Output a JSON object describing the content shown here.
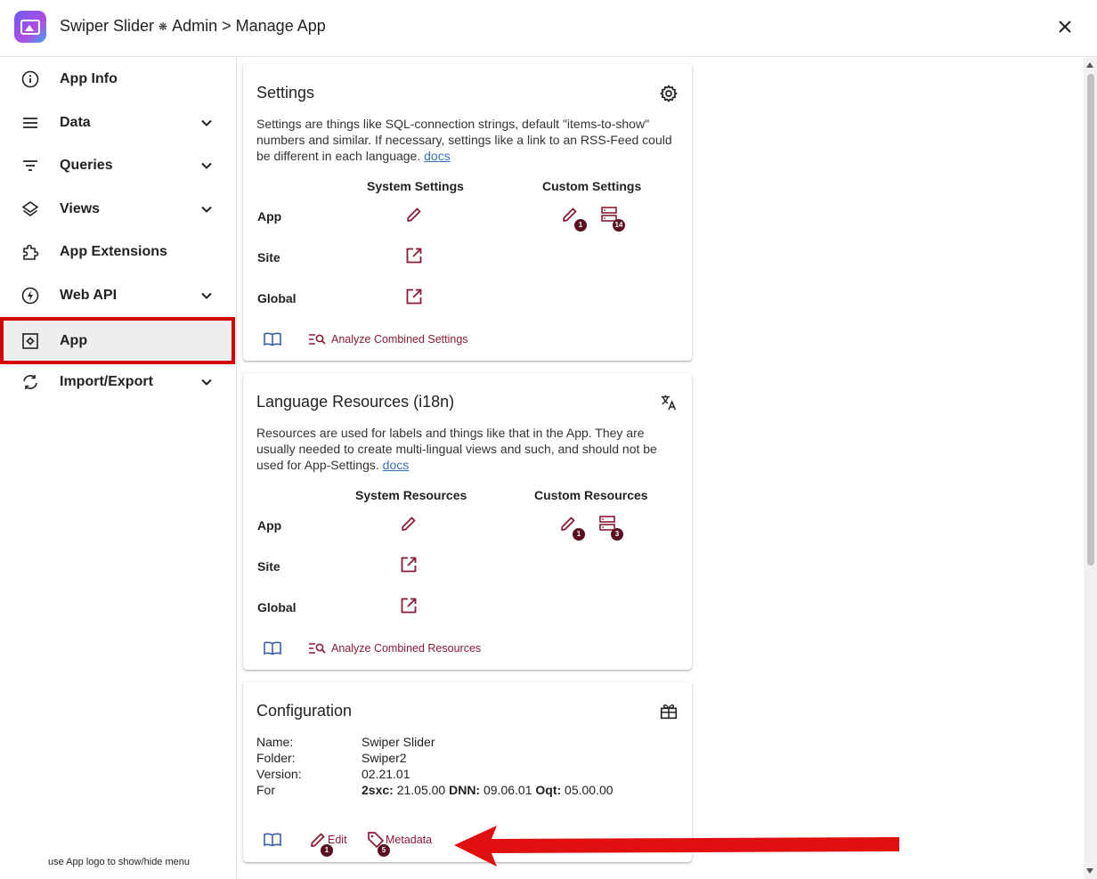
{
  "header": {
    "app_name": "Swiper Slider",
    "admin_label": "Admin",
    "separator": ">",
    "page_title": "Manage App"
  },
  "sidebar": {
    "items": [
      {
        "label": "App Info",
        "icon": "info-icon",
        "expandable": false
      },
      {
        "label": "Data",
        "icon": "list-icon",
        "expandable": true
      },
      {
        "label": "Queries",
        "icon": "filter-icon",
        "expandable": true
      },
      {
        "label": "Views",
        "icon": "layers-icon",
        "expandable": true
      },
      {
        "label": "App Extensions",
        "icon": "extension-icon",
        "expandable": false
      },
      {
        "label": "Web API",
        "icon": "bolt-icon",
        "expandable": true
      },
      {
        "label": "App",
        "icon": "settings-box-icon",
        "expandable": false,
        "active": true
      },
      {
        "label": "Import/Export",
        "icon": "sync-icon",
        "expandable": true
      }
    ],
    "hint": "use App logo to show/hide menu"
  },
  "settings_card": {
    "title": "Settings",
    "desc_text": "Settings are things like SQL-connection strings, default \"items-to-show\" numbers and similar. If necessary, settings like a link to an RSS-Feed could be different in each language.",
    "docs_link": "docs",
    "col_system": "System Settings",
    "col_custom": "Custom Settings",
    "rows": [
      "App",
      "Site",
      "Global"
    ],
    "custom_edit_badge": "1",
    "custom_list_badge": "14",
    "analyze_label": "Analyze Combined Settings"
  },
  "resources_card": {
    "title": "Language Resources (i18n)",
    "desc_text": "Resources are used for labels and things like that in the App. They are usually needed to create multi-lingual views and such, and should not be used for App-Settings.",
    "docs_link": "docs",
    "col_system": "System Resources",
    "col_custom": "Custom Resources",
    "rows": [
      "App",
      "Site",
      "Global"
    ],
    "custom_edit_badge": "1",
    "custom_list_badge": "3",
    "analyze_label": "Analyze Combined Resources"
  },
  "config_card": {
    "title": "Configuration",
    "name_key": "Name:",
    "name_val": "Swiper Slider",
    "folder_key": "Folder:",
    "folder_val": "Swiper2",
    "version_key": "Version:",
    "version_val": "02.21.01",
    "for_key": "For",
    "for_2sxc_label": "2sxc:",
    "for_2sxc_val": "21.05.00",
    "for_dnn_label": "DNN:",
    "for_dnn_val": "09.06.01",
    "for_oqt_label": "Oqt:",
    "for_oqt_val": "05.00.00",
    "edit_label": "Edit",
    "edit_badge": "1",
    "metadata_label": "Metadata",
    "metadata_badge": "5"
  },
  "colors": {
    "accent": "#8b1a36",
    "badge": "#5a1020",
    "link": "#3b6fb6",
    "highlight_border": "#d50000",
    "annotation_arrow": "#e01010"
  }
}
